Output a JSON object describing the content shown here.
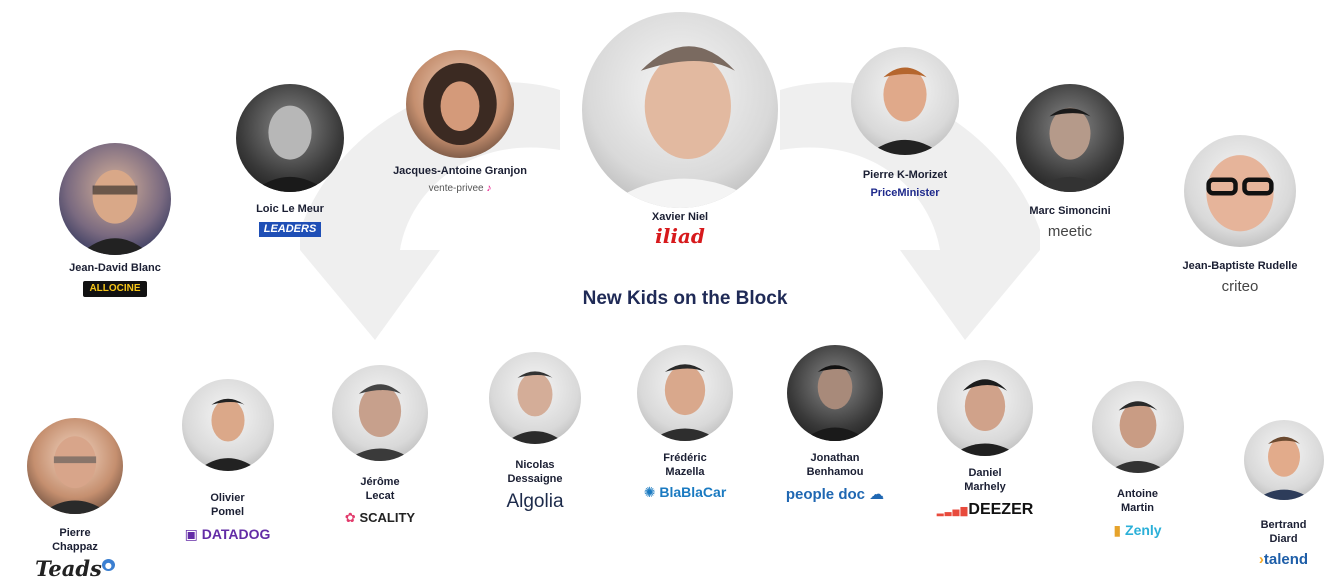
{
  "title": "New Kids on the Block",
  "colors": {
    "title": "#1f2a56",
    "names": "#1b1f33",
    "arrow": "#efefef"
  },
  "people": [
    {
      "id": "jdb",
      "name": "Jean-David Blanc",
      "company": "ALLOCINE"
    },
    {
      "id": "llm",
      "name": "Loic Le Meur",
      "company": "LEADERS"
    },
    {
      "id": "jag",
      "name": "Jacques-Antoine Granjon",
      "company": "vente-privee"
    },
    {
      "id": "xn",
      "name": "Xavier Niel",
      "company": "iliad"
    },
    {
      "id": "pkm",
      "name": "Pierre K-Morizet",
      "company": "PriceMinister"
    },
    {
      "id": "ms",
      "name": "Marc Simoncini",
      "company": "meetic"
    },
    {
      "id": "jbr",
      "name": "Jean-Baptiste Rudelle",
      "company": "criteo"
    },
    {
      "id": "pc",
      "name": "Pierre\nChappaz",
      "company": "Teads"
    },
    {
      "id": "op",
      "name": "Olivier\nPomel",
      "company": "DATADOG"
    },
    {
      "id": "jl",
      "name": "Jérôme\nLecat",
      "company": "SCALITY"
    },
    {
      "id": "nd",
      "name": "Nicolas\nDessaigne",
      "company": "Algolia"
    },
    {
      "id": "fm",
      "name": "Frédéric\nMazella",
      "company": "BlaBlaCar"
    },
    {
      "id": "jb",
      "name": "Jonathan\nBenhamou",
      "company": "people doc"
    },
    {
      "id": "dm",
      "name": "Daniel\nMarhely",
      "company": "DEEZER"
    },
    {
      "id": "am",
      "name": "Antoine\nMartin",
      "company": "Zenly"
    },
    {
      "id": "bd",
      "name": "Bertrand\nDiard",
      "company": "talend"
    }
  ]
}
